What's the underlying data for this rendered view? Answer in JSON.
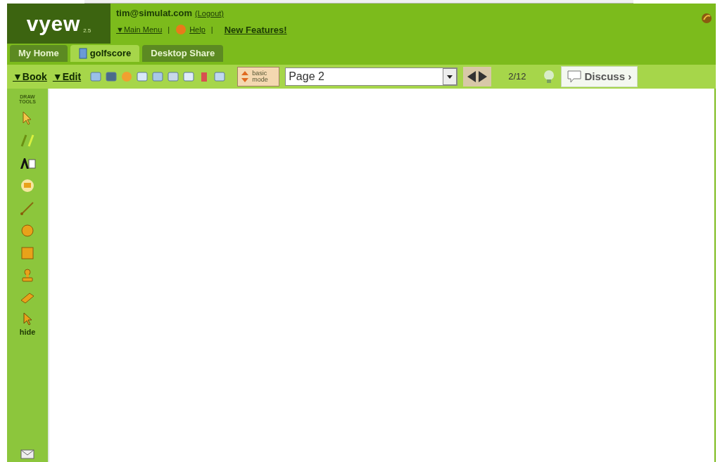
{
  "logo": {
    "text": "vyew",
    "version": "2.5"
  },
  "user": {
    "email": "tim@simulat.com",
    "logout": "(Logout)"
  },
  "menu_links": [
    {
      "kind": "menu",
      "label": "▼Main Menu"
    },
    {
      "kind": "sep",
      "label": "|"
    },
    {
      "kind": "help",
      "label": "Help"
    },
    {
      "kind": "sep",
      "label": "|"
    },
    {
      "kind": "link",
      "label": "New Features!"
    }
  ],
  "tabs": [
    {
      "label": "My Home",
      "selected": false,
      "kind": "plain"
    },
    {
      "label": "golfscore",
      "selected": true,
      "kind": "doc"
    },
    {
      "label": "Desktop Share",
      "selected": false,
      "kind": "plain"
    }
  ],
  "toolbar": {
    "menus": [
      "▼Book",
      "▼Edit"
    ],
    "mode_label": "basic mode",
    "page_select": {
      "value": "Page 2"
    },
    "page_count": "2/12",
    "discuss": "Discuss ›"
  },
  "draw_tools": {
    "title": "DRAW TOOLS",
    "tools": [
      {
        "kind": "pointer"
      },
      {
        "kind": "pen"
      },
      {
        "kind": "text"
      },
      {
        "kind": "note"
      },
      {
        "kind": "line"
      },
      {
        "kind": "circle"
      },
      {
        "kind": "square"
      },
      {
        "kind": "stamp"
      },
      {
        "kind": "eraser"
      }
    ],
    "hide": "hide"
  }
}
